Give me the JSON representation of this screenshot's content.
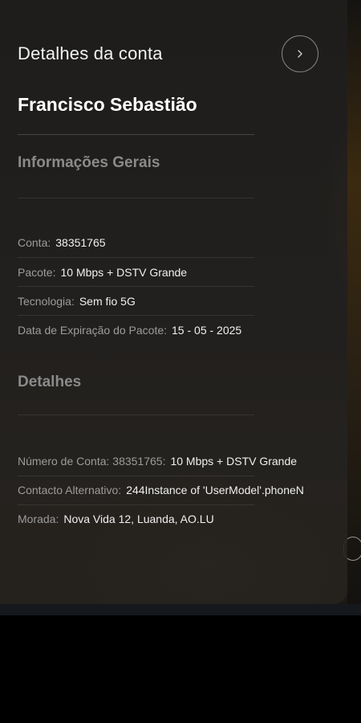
{
  "drawer": {
    "title": "Detalhes da conta",
    "user_name": "Francisco Sebastião"
  },
  "general": {
    "title": "Informações Gerais",
    "rows": [
      {
        "label": "Conta:",
        "value": "38351765"
      },
      {
        "label": "Pacote:",
        "value": "10 Mbps + DSTV Grande"
      },
      {
        "label": "Tecnologia:",
        "value": "Sem fio 5G"
      },
      {
        "label": "Data de Expiração do Pacote:",
        "value": "15 - 05 - 2025"
      }
    ]
  },
  "details": {
    "title": "Detalhes",
    "rows": [
      {
        "label": "Número de Conta: 38351765:",
        "value": "10 Mbps + DSTV Grande"
      },
      {
        "label": "Contacto Alternativo:",
        "value": "244Instance of 'UserModel'.phoneN"
      },
      {
        "label": "Morada:",
        "value": "Nova Vida 12, Luanda, AO.LU"
      }
    ]
  },
  "icons": {
    "close": "chevron-right-icon"
  },
  "colors": {
    "text_primary": "#f0f0f0",
    "text_label": "#9c9c9c",
    "section_title": "#8a8a8a",
    "drawer_bg": "#1f1e1c"
  }
}
